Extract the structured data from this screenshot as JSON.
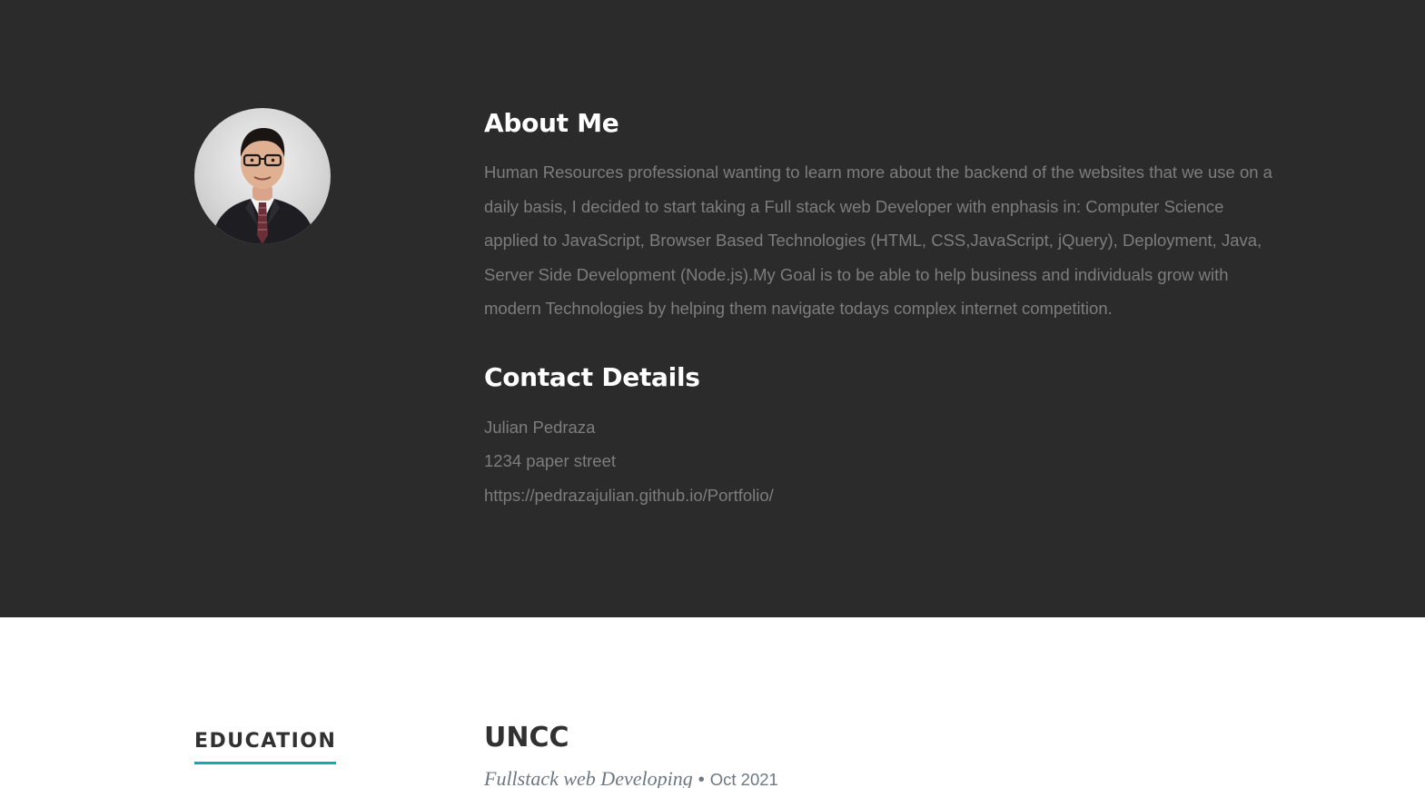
{
  "about": {
    "title": "About Me",
    "text": "Human Resources professional wanting to learn more about the backend of the websites that we use on a daily basis, I decided to start taking a Full stack web Developer with enphasis in: Computer Science applied to JavaScript, Browser Based Technologies (HTML, CSS,JavaScript, jQuery), Deployment, Java, Server Side Development (Node.js).My Goal is to be able to help business and individuals grow with modern Technologies by helping them navigate todays complex internet competition."
  },
  "contact": {
    "title": "Contact Details",
    "name": "Julian Pedraza",
    "address": "1234 paper street",
    "website": "https://pedrazajulian.github.io/Portfolio/"
  },
  "education": {
    "heading": "EDUCATION",
    "school": "UNCC",
    "degree": "Fullstack web Developing",
    "bullet": "•",
    "date": "Oct 2021"
  },
  "colors": {
    "dark_background": "#2b2b2b",
    "body_text": "#7d7d7d",
    "accent": "#11abb0",
    "heading_dark": "#313131"
  }
}
